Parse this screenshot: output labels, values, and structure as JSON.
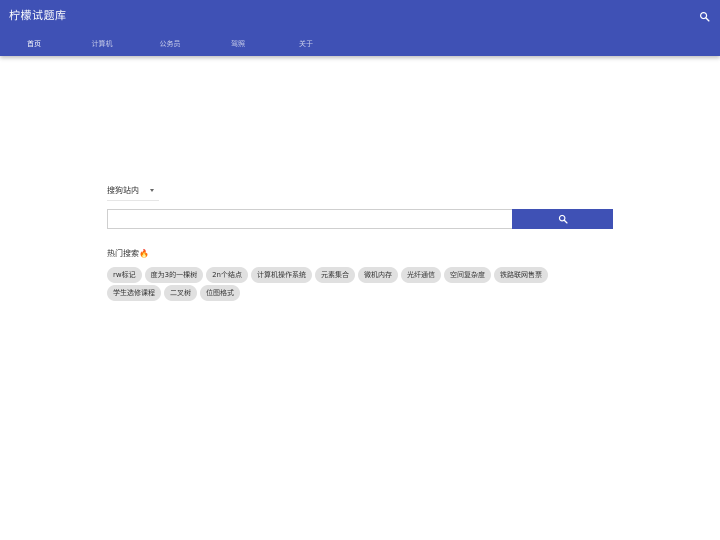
{
  "colors": {
    "brand": "#3f51b5",
    "chip_bg": "#e0e0e0"
  },
  "header": {
    "title": "柠檬试题库",
    "search_icon": "search-icon"
  },
  "nav": {
    "tabs": [
      {
        "label": "首页",
        "active": true
      },
      {
        "label": "计算机",
        "active": false
      },
      {
        "label": "公务员",
        "active": false
      },
      {
        "label": "驾照",
        "active": false
      },
      {
        "label": "关于",
        "active": false
      }
    ]
  },
  "search": {
    "source_selected": "搜狗站内",
    "input_value": "",
    "button_icon": "search-icon"
  },
  "hot": {
    "label": "热门搜索🔥",
    "chips": [
      "rw标记",
      "度为3的一棵树",
      "2n个结点",
      "计算机操作系统",
      "元素集合",
      "微机内存",
      "光纤通信",
      "空间复杂度",
      "铁路联网售票",
      "学生选修课程",
      "二叉树",
      "位图格式"
    ]
  }
}
